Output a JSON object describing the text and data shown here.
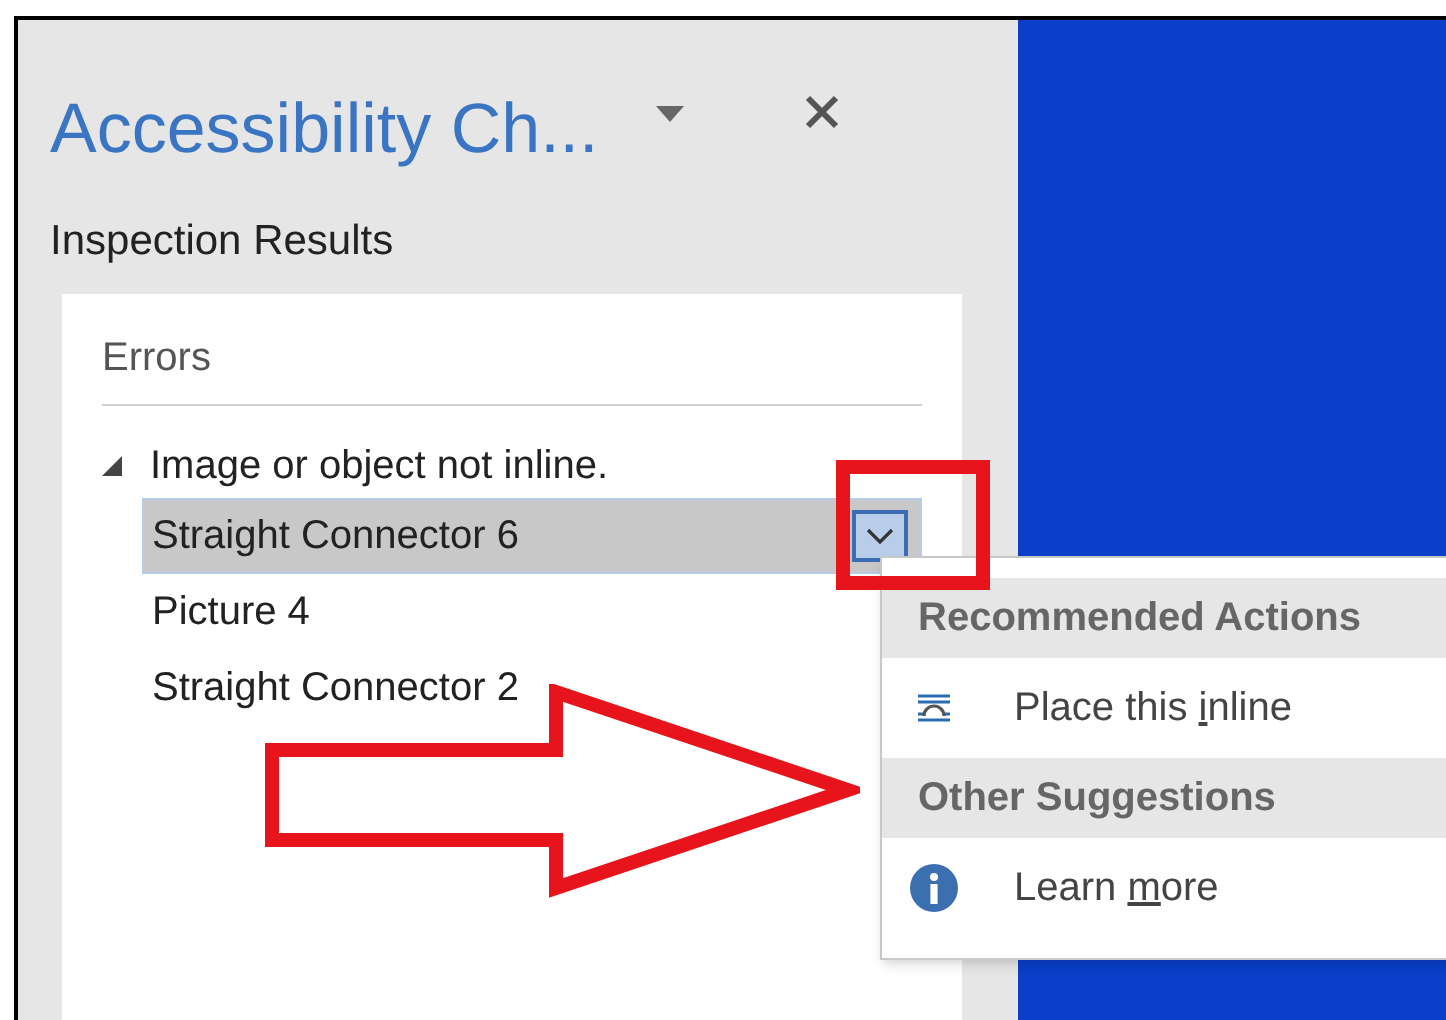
{
  "pane": {
    "title": "Accessibility Ch...",
    "section_label": "Inspection Results"
  },
  "results": {
    "heading": "Errors",
    "groups": [
      {
        "label": "Image or object not inline.",
        "expanded": true,
        "children": [
          {
            "label": "Straight Connector 6",
            "selected": true
          },
          {
            "label": "Picture 4",
            "selected": false
          },
          {
            "label": "Straight Connector 2",
            "selected": false
          }
        ]
      }
    ]
  },
  "menu": {
    "sections": [
      {
        "heading": "Recommended Actions",
        "items": [
          {
            "kind": "inline",
            "before": "Place this ",
            "access_key": "i",
            "after": "nline"
          }
        ]
      },
      {
        "heading": "Other Suggestions",
        "items": [
          {
            "kind": "info",
            "before": "Learn ",
            "access_key": "m",
            "after": "ore"
          }
        ]
      }
    ]
  }
}
